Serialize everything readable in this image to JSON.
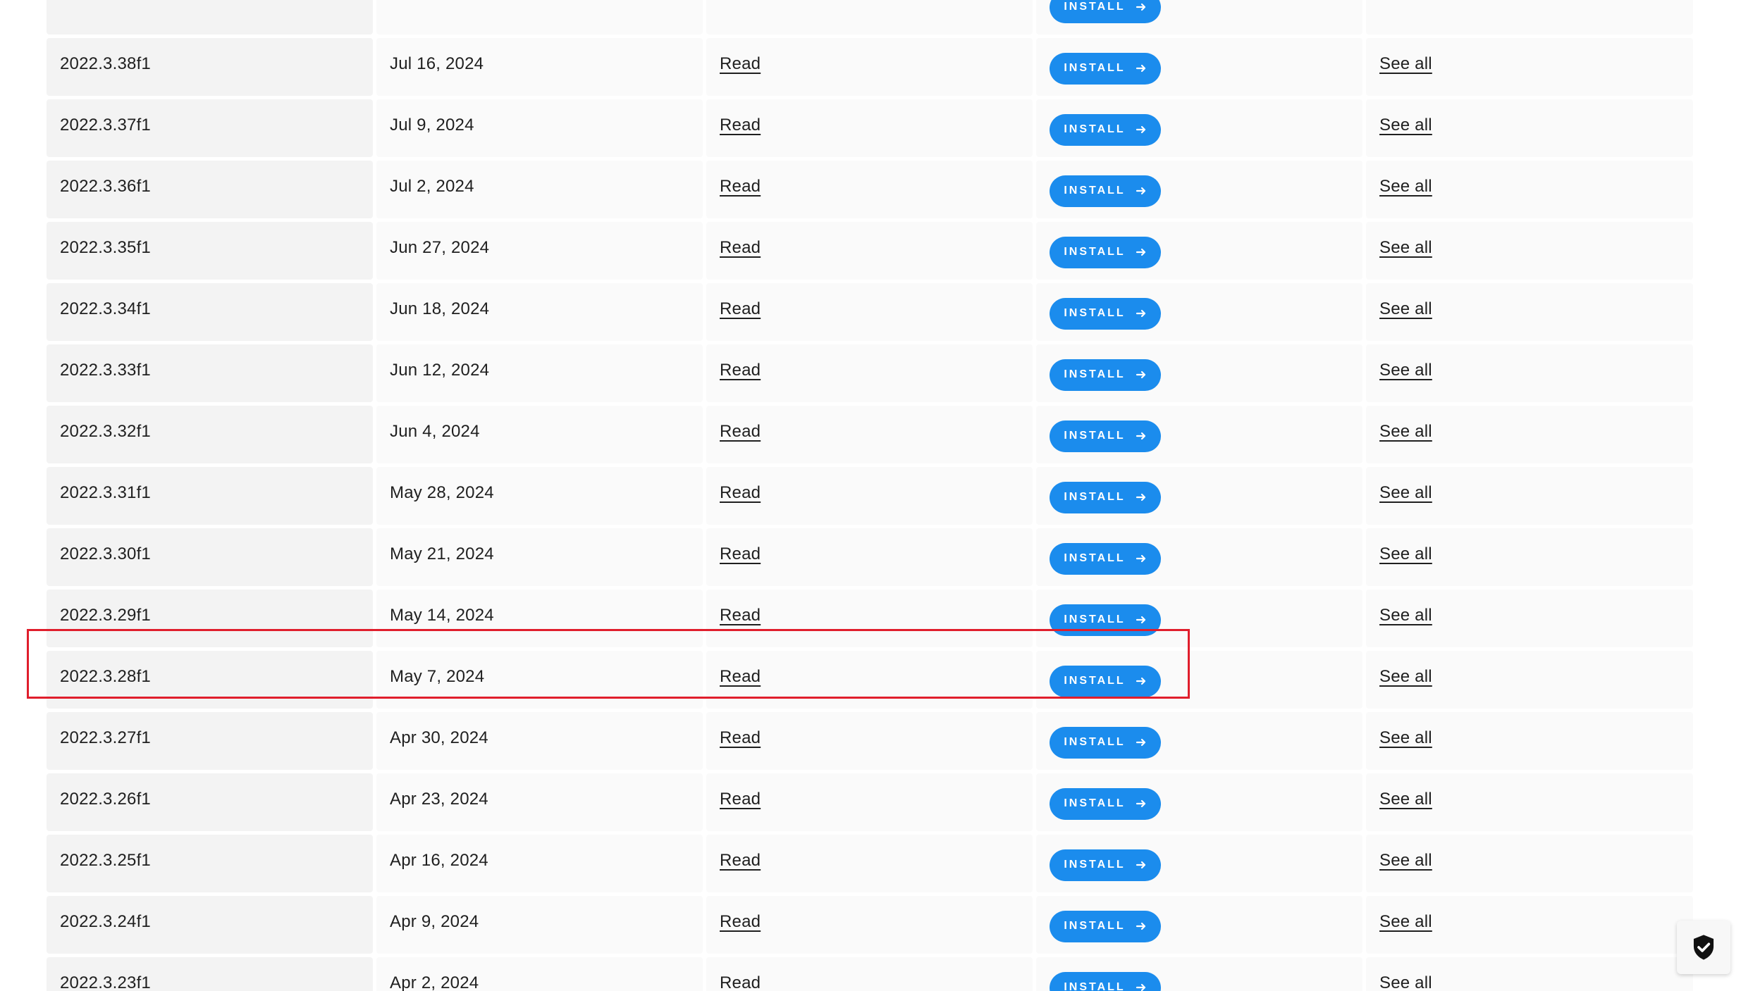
{
  "releases": [
    {
      "version": "",
      "date": "",
      "notes_label": "",
      "install_label": "INSTALL",
      "modules_label": ""
    },
    {
      "version": "2022.3.38f1",
      "date": "Jul 16, 2024",
      "notes_label": "Read",
      "install_label": "INSTALL",
      "modules_label": "See all"
    },
    {
      "version": "2022.3.37f1",
      "date": "Jul 9, 2024",
      "notes_label": "Read",
      "install_label": "INSTALL",
      "modules_label": "See all"
    },
    {
      "version": "2022.3.36f1",
      "date": "Jul 2, 2024",
      "notes_label": "Read",
      "install_label": "INSTALL",
      "modules_label": "See all"
    },
    {
      "version": "2022.3.35f1",
      "date": "Jun 27, 2024",
      "notes_label": "Read",
      "install_label": "INSTALL",
      "modules_label": "See all"
    },
    {
      "version": "2022.3.34f1",
      "date": "Jun 18, 2024",
      "notes_label": "Read",
      "install_label": "INSTALL",
      "modules_label": "See all"
    },
    {
      "version": "2022.3.33f1",
      "date": "Jun 12, 2024",
      "notes_label": "Read",
      "install_label": "INSTALL",
      "modules_label": "See all"
    },
    {
      "version": "2022.3.32f1",
      "date": "Jun 4, 2024",
      "notes_label": "Read",
      "install_label": "INSTALL",
      "modules_label": "See all"
    },
    {
      "version": "2022.3.31f1",
      "date": "May 28, 2024",
      "notes_label": "Read",
      "install_label": "INSTALL",
      "modules_label": "See all"
    },
    {
      "version": "2022.3.30f1",
      "date": "May 21, 2024",
      "notes_label": "Read",
      "install_label": "INSTALL",
      "modules_label": "See all"
    },
    {
      "version": "2022.3.29f1",
      "date": "May 14, 2024",
      "notes_label": "Read",
      "install_label": "INSTALL",
      "modules_label": "See all"
    },
    {
      "version": "2022.3.28f1",
      "date": "May 7, 2024",
      "notes_label": "Read",
      "install_label": "INSTALL",
      "modules_label": "See all"
    },
    {
      "version": "2022.3.27f1",
      "date": "Apr 30, 2024",
      "notes_label": "Read",
      "install_label": "INSTALL",
      "modules_label": "See all"
    },
    {
      "version": "2022.3.26f1",
      "date": "Apr 23, 2024",
      "notes_label": "Read",
      "install_label": "INSTALL",
      "modules_label": "See all"
    },
    {
      "version": "2022.3.25f1",
      "date": "Apr 16, 2024",
      "notes_label": "Read",
      "install_label": "INSTALL",
      "modules_label": "See all"
    },
    {
      "version": "2022.3.24f1",
      "date": "Apr 9, 2024",
      "notes_label": "Read",
      "install_label": "INSTALL",
      "modules_label": "See all"
    },
    {
      "version": "2022.3.23f1",
      "date": "Apr 2, 2024",
      "notes_label": "Read",
      "install_label": "INSTALL",
      "modules_label": "See all"
    }
  ],
  "highlighted_version": "2022.3.28f1",
  "icons": {
    "install_arrow": "arrow-right-icon",
    "floating_button": "shield-check-icon"
  },
  "colors": {
    "install_button": "#1b8ced",
    "highlight_border": "#e01e2c",
    "row_background": "#fafafa",
    "version_cell_background": "#f3f3f3"
  }
}
